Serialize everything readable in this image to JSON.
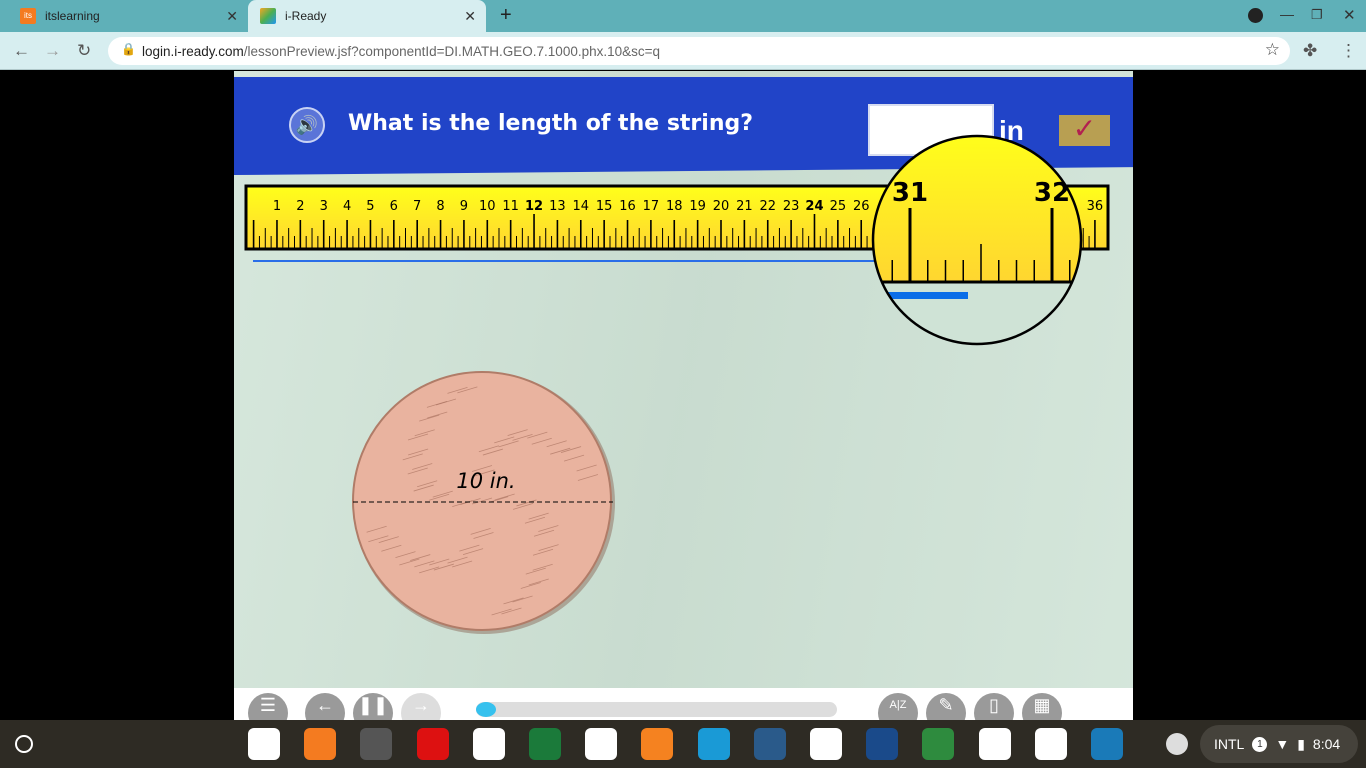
{
  "browser": {
    "tabs": [
      {
        "title": "itslearning",
        "favicon": "its"
      },
      {
        "title": "i-Ready",
        "active": true
      }
    ],
    "new_tab": "+",
    "url_host": "login.i-ready.com",
    "url_path": "/lessonPreview.jsf?componentId=DI.MATH.GEO.7.1000.phx.10&sc=q"
  },
  "lesson": {
    "question": "What is the length of the string?",
    "answer_value": "",
    "unit": "in",
    "ruler_max": 36,
    "ruler_bold": [
      12,
      24
    ],
    "ruler_visible_numbers": [
      1,
      2,
      3,
      4,
      5,
      6,
      7,
      8,
      9,
      10,
      11,
      12,
      13,
      14,
      15,
      16,
      17,
      18,
      19,
      20,
      21,
      22,
      23,
      24,
      25,
      26,
      36
    ],
    "magnifier_labels": [
      "31",
      "32"
    ],
    "circle_label": "10 in.",
    "progress_fraction": 0.03,
    "colors": {
      "header": "#2144c8",
      "ruler": "#ffff1a",
      "string": "#2a6ee8",
      "circle": "#e9b39f"
    }
  },
  "controls": [
    "menu",
    "back",
    "pause",
    "forward",
    "glossary",
    "pencil",
    "notepad",
    "calculator"
  ],
  "glossary_label": "A|Z",
  "shelf": {
    "apps": [
      "chrome",
      "its",
      "camera",
      "cube",
      "circle-app",
      "desmos",
      "geogebra",
      "share",
      "sora",
      "butterfly",
      "ck12",
      "typingclub",
      "classroom",
      "drive",
      "class",
      "education"
    ],
    "ime": "INTL",
    "notif": "1",
    "time": "8:04"
  }
}
